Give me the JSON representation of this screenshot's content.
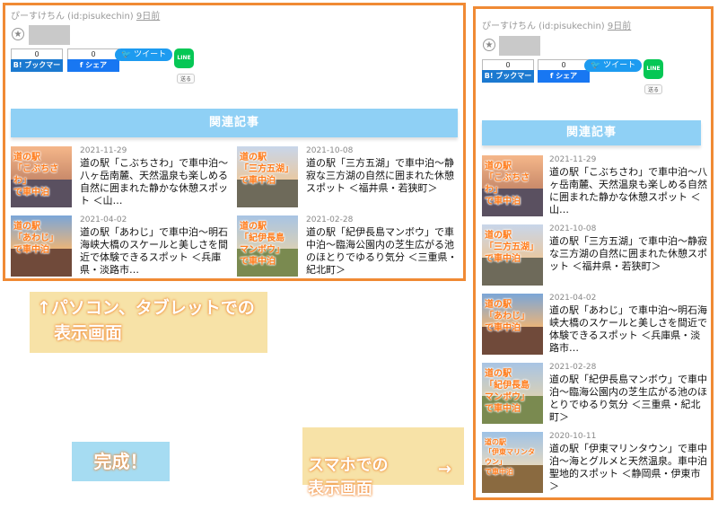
{
  "author": {
    "name": "ぴーすけちん (id:pisukechin)",
    "ago": "9日前"
  },
  "share": {
    "hatena": {
      "count": "0",
      "label": "B! ブックマーク"
    },
    "facebook": {
      "count": "0",
      "label": "f シェア"
    },
    "twitter": {
      "label": "ツイート"
    },
    "line": {
      "label": "LINE",
      "send": "送る"
    }
  },
  "related": {
    "heading": "関連記事",
    "articles": [
      {
        "date": "2021-11-29",
        "title": "道の駅「こぶちさわ」で車中泊～八ヶ岳南麓、天然温泉も楽しめる自然に囲まれた静かな休憩スポット ＜山…",
        "thumb_text": "道の駅\n「こぶちさわ」\nで車中泊"
      },
      {
        "date": "2021-10-08",
        "title": "道の駅「三方五湖」で車中泊～静寂な三方湖の自然に囲まれた休憩スポット ＜福井県・若狭町＞",
        "thumb_text": "道の駅\n「三方五湖」\nで車中泊"
      },
      {
        "date": "2021-04-02",
        "title": "道の駅「あわじ」で車中泊～明石海峡大橋のスケールと美しさを間近で体験できるスポット ＜兵庫県・淡路市…",
        "thumb_text": "道の駅\n「あわじ」\nで車中泊"
      },
      {
        "date": "2021-02-28",
        "title": "道の駅「紀伊長島マンボウ」で車中泊～臨海公園内の芝生広がる池のほとりでゆるり気分 ＜三重県・紀北町＞",
        "thumb_text": "道の駅\n「紀伊長島\nマンボウ」\nで車中泊"
      },
      {
        "date": "2020-10-11",
        "title": "道の駅「伊東マリンタウン」で車中泊～海とグルメと天然温泉。車中泊聖地的スポット ＜静岡県・伊東市＞",
        "thumb_text": "道の駅\n「伊東マリンタウン」\nで車中泊"
      }
    ]
  },
  "annotations": {
    "pc": "↑パソコン、タブレットでの\n　表示画面",
    "done": "完成！",
    "sp": "スマホでの\n表示画面",
    "sp_arrow": "→"
  },
  "colors": {
    "frame": "#f08a34",
    "heading": "#8fd0f5"
  }
}
